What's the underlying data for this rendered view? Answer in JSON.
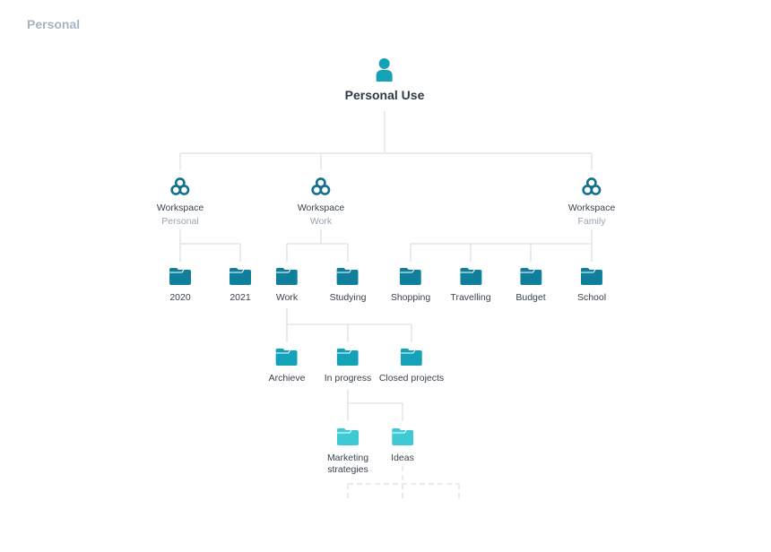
{
  "section_title": "Personal",
  "colors": {
    "line": "#dfe6ec",
    "dark_teal": "#0f7f9b",
    "mid_teal": "#14a2b8",
    "light_teal": "#3fc9d2",
    "workspace_icon": "#10708e"
  },
  "root": {
    "icon": "user-icon",
    "label": "Personal Use"
  },
  "workspaces": [
    {
      "icon": "workspace-icon",
      "label": "Workspace",
      "sub": "Personal",
      "folders": [
        {
          "icon": "folder-icon",
          "label": "2020"
        },
        {
          "icon": "folder-icon",
          "label": "2021"
        }
      ]
    },
    {
      "icon": "workspace-icon",
      "label": "Workspace",
      "sub": "Work",
      "folders": [
        {
          "icon": "folder-icon",
          "label": "Work",
          "children": [
            {
              "icon": "folder-icon",
              "label": "Archieve"
            },
            {
              "icon": "folder-icon",
              "label": "In progress",
              "children": [
                {
                  "icon": "folder-icon",
                  "label": "Marketing strategies"
                },
                {
                  "icon": "folder-icon",
                  "label": "Ideas"
                }
              ]
            },
            {
              "icon": "folder-icon",
              "label": "Closed projects"
            }
          ]
        },
        {
          "icon": "folder-icon",
          "label": "Studying"
        }
      ]
    },
    {
      "icon": "workspace-icon",
      "label": "Workspace",
      "sub": "Family",
      "folders": [
        {
          "icon": "folder-icon",
          "label": "Shopping"
        },
        {
          "icon": "folder-icon",
          "label": "Travelling"
        },
        {
          "icon": "folder-icon",
          "label": "Budget"
        },
        {
          "icon": "folder-icon",
          "label": "School"
        }
      ]
    }
  ]
}
